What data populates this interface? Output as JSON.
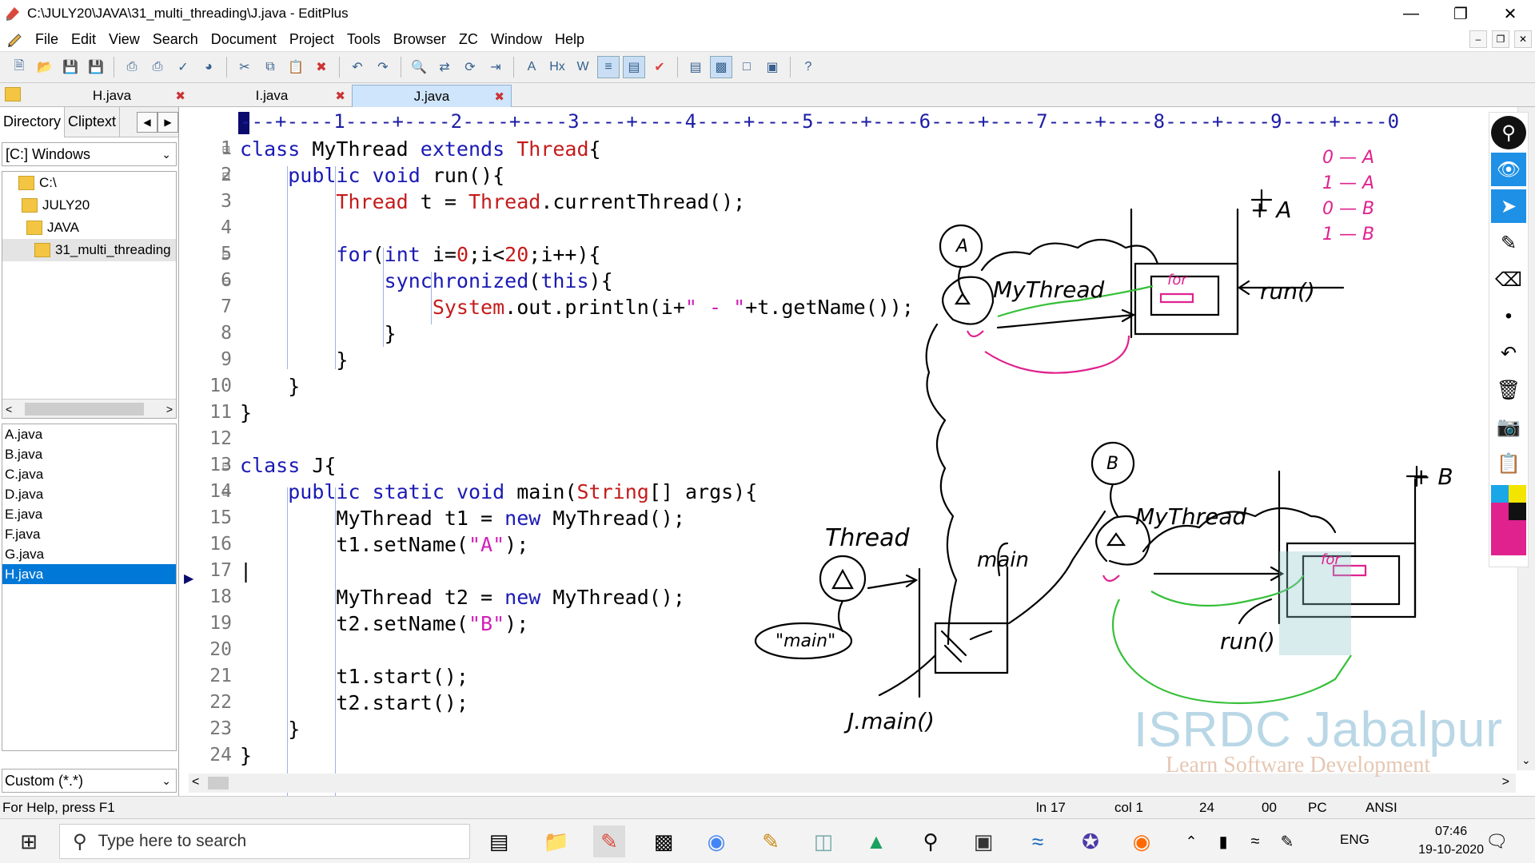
{
  "window": {
    "title": "C:\\JULY20\\JAVA\\31_multi_threading\\J.java - EditPlus"
  },
  "menu": [
    "File",
    "Edit",
    "View",
    "Search",
    "Document",
    "Project",
    "Tools",
    "Browser",
    "ZC",
    "Window",
    "Help"
  ],
  "tabs": [
    {
      "label": "H.java",
      "active": false
    },
    {
      "label": "I.java",
      "active": false
    },
    {
      "label": "J.java",
      "active": true
    }
  ],
  "left_panel": {
    "tab_directory": "Directory",
    "tab_cliptext": "Cliptext",
    "drive": "[C:] Windows",
    "tree": [
      "C:\\",
      "JULY20",
      "JAVA",
      "31_multi_threading"
    ],
    "files": [
      "A.java",
      "B.java",
      "C.java",
      "D.java",
      "E.java",
      "F.java",
      "G.java",
      "H.java"
    ],
    "selected_file": "H.java",
    "filter": "Custom (*.*)"
  },
  "ruler": "---+----1----+----2----+----3----+----4----+----5----+----6----+----7----+----8----+----9----+----0",
  "editor": {
    "line_numbers": [
      "1",
      "2",
      "3",
      "4",
      "5",
      "6",
      "7",
      "8",
      "9",
      "10",
      "11",
      "12",
      "13",
      "14",
      "15",
      "16",
      "17",
      "18",
      "19",
      "20",
      "21",
      "22",
      "23",
      "24"
    ],
    "current_line": 17
  },
  "status": {
    "help": "For Help, press F1",
    "ln": "ln 17",
    "col": "col 1",
    "count": "24",
    "num": "00",
    "mode": "PC",
    "encoding": "ANSI"
  },
  "taskbar": {
    "search_placeholder": "Type here to search",
    "lang": "ENG",
    "time": "07:46",
    "date": "19-10-2020"
  },
  "watermark": {
    "title": "ISRDC Jabalpur",
    "subtitle": "Learn Software Development"
  },
  "annotations": {
    "thread": "Thread",
    "main_quote": "\"main\"",
    "main": "main",
    "jmain": "J.main()",
    "mythread1": "MyThread",
    "mythread2": "MyThread",
    "run1": "run()",
    "run2": "run()",
    "for1": "for",
    "for2": "for",
    "thread_a": "A",
    "thread_b": "B",
    "tA": "+ A",
    "tB": "+ B",
    "out": [
      "0 — A",
      "1 — A",
      "0 — B",
      "1 — B"
    ]
  }
}
